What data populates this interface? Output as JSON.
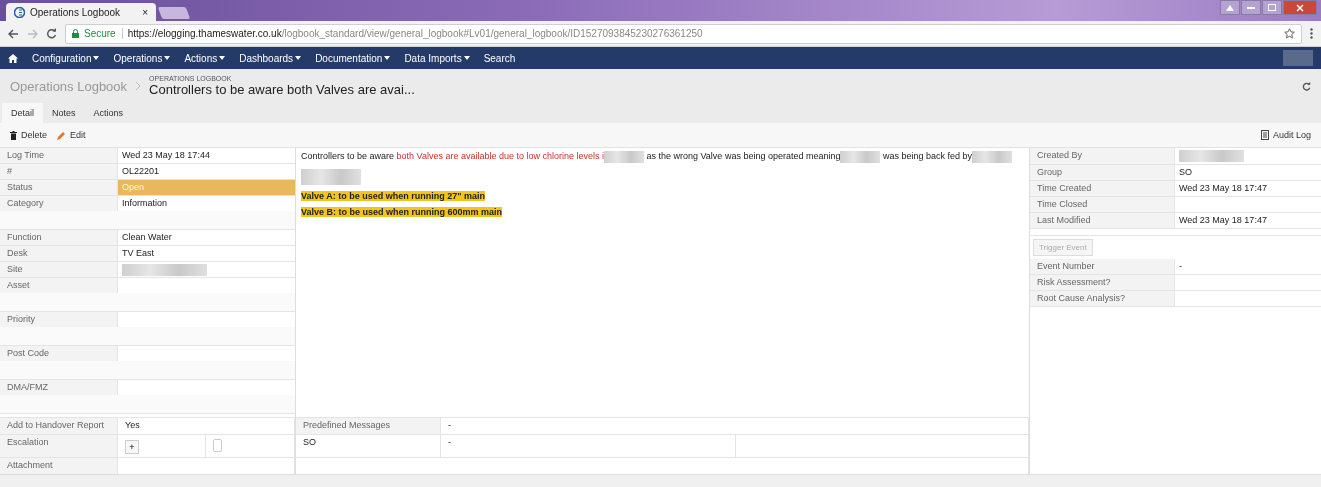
{
  "browser": {
    "tab_title": "Operations Logbook",
    "tab_close": "×",
    "secure_label": "Secure",
    "url_host": "https://elogging.thameswater.co.uk",
    "url_path": "/logbook_standard/view/general_logbook#Lv01/general_logbook/ID1527093845230276361250"
  },
  "nav": {
    "items": [
      {
        "label": "Configuration",
        "dropdown": true
      },
      {
        "label": "Operations",
        "dropdown": true
      },
      {
        "label": "Actions",
        "dropdown": true
      },
      {
        "label": "Dashboards",
        "dropdown": true
      },
      {
        "label": "Documentation",
        "dropdown": true
      },
      {
        "label": "Data Imports",
        "dropdown": true
      },
      {
        "label": "Search",
        "dropdown": false
      }
    ]
  },
  "header": {
    "breadcrumb": "Operations Logbook",
    "caption": "OPERATIONS LOGBOOK",
    "title": "Controllers to be aware both Valves are avai..."
  },
  "tabs": [
    {
      "label": "Detail",
      "selected": true
    },
    {
      "label": "Notes",
      "selected": false
    },
    {
      "label": "Actions",
      "selected": false
    }
  ],
  "toolbar": {
    "delete": "Delete",
    "edit": "Edit",
    "audit_log": "Audit Log"
  },
  "left_fields": [
    {
      "label": "Log Time",
      "value": "Wed 23 May 18 17:44",
      "highlight": false,
      "redacted": false,
      "gap_after": false
    },
    {
      "label": "#",
      "value": "OL22201",
      "highlight": false,
      "redacted": false,
      "gap_after": false
    },
    {
      "label": "Status",
      "value": "Open",
      "highlight": true,
      "redacted": false,
      "gap_after": false
    },
    {
      "label": "Category",
      "value": "Information",
      "highlight": false,
      "redacted": false,
      "gap_after": true
    },
    {
      "label": "Function",
      "value": "Clean Water",
      "highlight": false,
      "redacted": false,
      "gap_after": false
    },
    {
      "label": "Desk",
      "value": "TV East",
      "highlight": false,
      "redacted": false,
      "gap_after": false
    },
    {
      "label": "Site",
      "highlight": false,
      "redacted": true,
      "gap_after": false
    },
    {
      "label": "Asset",
      "highlight": false,
      "redacted": false,
      "gap_after": true
    },
    {
      "label": "Priority",
      "highlight": false,
      "redacted": false,
      "gap_after": true
    },
    {
      "label": "Post Code",
      "highlight": false,
      "redacted": false,
      "gap_after": true
    },
    {
      "label": "DMA/FMZ",
      "highlight": false,
      "redacted": false,
      "gap_after": true
    }
  ],
  "message": {
    "segments": [
      {
        "kind": "text",
        "text": "Controllers to be aware "
      },
      {
        "kind": "red",
        "text": "both Valves are available due to low chlorine levels i"
      },
      {
        "kind": "redacted"
      },
      {
        "kind": "text",
        "text": " as the wrong Valve was being operated meaning"
      },
      {
        "kind": "redacted"
      },
      {
        "kind": "text",
        "text": " was being back fed by"
      },
      {
        "kind": "redacted"
      }
    ],
    "notes": [
      "Valve A: to be used when running 27\" main",
      "Valve B: to be used when running 600mm main"
    ]
  },
  "bottom": {
    "handover_label": "Add to Handover Report",
    "handover_value": "Yes",
    "predefined_label": "Predefined Messages",
    "predefined_value": "-",
    "escalation_label": "Escalation",
    "escalation_add": "+",
    "escalation_checked": false,
    "escalation_group": "SO",
    "escalation_value": "-",
    "attachment_label": "Attachment"
  },
  "right_fields": [
    {
      "label": "Created By",
      "redacted": true
    },
    {
      "label": "Group",
      "value": "SO",
      "redacted": false
    },
    {
      "label": "Time Created",
      "value": "Wed 23 May 18 17:47",
      "redacted": false
    },
    {
      "label": "Time Closed",
      "redacted": false
    },
    {
      "label": "Last Modified",
      "value": "Wed 23 May 18 17:47",
      "redacted": false
    }
  ],
  "trigger_button": {
    "label": "Trigger Event",
    "disabled": true
  },
  "event_fields": [
    {
      "label": "Event Number",
      "value": "-"
    },
    {
      "label": "Risk Assessment?"
    },
    {
      "label": "Root Cause Analysis?"
    }
  ]
}
